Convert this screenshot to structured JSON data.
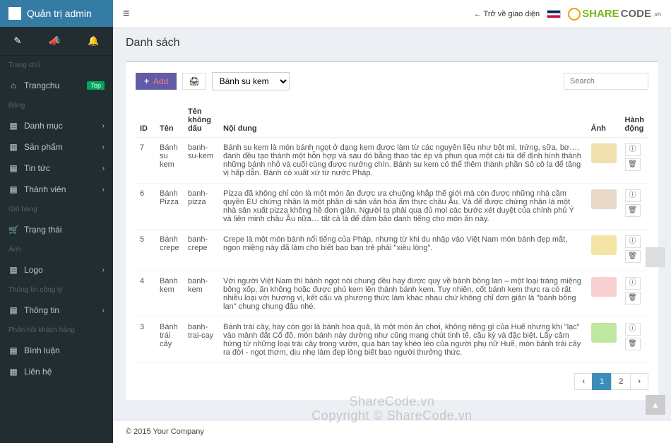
{
  "brand": {
    "title": "Quản trị admin"
  },
  "sidebar": {
    "headers": {
      "h1": "Trang chủ",
      "h2": "Bảng",
      "h3": "Giỏ hàng",
      "h4": "Ảnh",
      "h5": "Thông tin công ty",
      "h6": "Phản hồi khách hàng"
    },
    "items": {
      "trangchu": "Trangchu",
      "danhmuc": "Danh mục",
      "sanpham": "Sản phẩm",
      "tintuc": "Tin tức",
      "thanhvien": "Thành viên",
      "trangthai": "Trạng thái",
      "logo": "Logo",
      "thongtin": "Thông tin",
      "binhluan": "Bình luận",
      "lienhe": "Liên hệ"
    },
    "badge_top": "Top"
  },
  "topbar": {
    "back": "Trở về giao diện",
    "flags": "🇬🇧"
  },
  "logo": {
    "main": "SHARE",
    "sub": "CODE",
    "tld": ".vn"
  },
  "page": {
    "header": "Danh sách",
    "add_label": "Add",
    "category": "Bánh su kem",
    "search_placeholder": "Search"
  },
  "table": {
    "headers": {
      "id": "ID",
      "ten": "Tên",
      "slug": "Tên không dấu",
      "noidung": "Nội dung",
      "anh": "Ảnh",
      "hanhdong": "Hành động"
    },
    "rows": [
      {
        "id": "7",
        "ten": "Bánh su kem",
        "slug": "banh-su-kem",
        "content": "Bánh su kem là món bánh ngọt ở dạng kem được làm từ các nguyên liệu như bột mì, trứng, sữa, bơ…. đánh đều tạo thành một hỗn hợp và sau đó bằng thao tác ép và phun qua một cái túi để định hình thành những bánh nhỏ và cuối cùng được nướng chín. Bánh su kem có thể thêm thành phần Sô cô la để tăng vị hấp dẫn. Bánh có xuất xứ từ nước Pháp."
      },
      {
        "id": "6",
        "ten": "Bánh Pizza",
        "slug": "banh-pizza",
        "content": "Pizza đã không chỉ còn là một món ăn được ưa chuộng khắp thế giới mà còn được những nhà cầm quyền EU chứng nhận là một phần di sản văn hóa ẩm thực châu Âu. Và để được chứng nhận là một nhà sản xuất pizza không hề đơn giản. Người ta phải qua đủ mọi các bước xét duyệt của chính phủ Ý và liên minh châu Âu nữa… tất cả là để đảm bảo danh tiếng cho món ăn này."
      },
      {
        "id": "5",
        "ten": "Bánh crepe",
        "slug": "banh-crepe",
        "content": "Crepe là một món bánh nổi tiếng của Pháp, nhưng từ khi du nhập vào Việt Nam món bánh đẹp mắt, ngon miệng này đã làm cho biết bao bạn trẻ phải \"xiêu lòng\"."
      },
      {
        "id": "4",
        "ten": "Bánh kem",
        "slug": "banh-kem",
        "content": "Với người Việt Nam thì bánh ngọt nói chung đều hay được quy về bánh bông lan – một loại tráng miệng bông xốp, ăn không hoặc được phủ kem lên thành bánh kem. Tuy nhiên, cốt bánh kem thực ra có rất nhiều loại với hương vị, kết cấu và phương thức làm khác nhau chứ không chỉ đơn giản là \"bánh bông lan\" chung chung đâu nhé."
      },
      {
        "id": "3",
        "ten": "Bánh trái cây",
        "slug": "banh-trai-cay",
        "content": "Bánh trái cây, hay còn gọi là bánh hoa quả, là một món ăn chơi, không riêng gì của Huế nhưng khi \"lạc\" vào mảnh đất Cố đô, món bánh này dường như cũng mang chút tinh tế, cầu kỳ và đặc biệt. Lấy cảm hứng từ những loại trái cây trong vườn, qua bàn tay khéo léo của người phụ nữ Huế, món bánh trái cây ra đời - ngọt thơm, dịu nhẹ làm đẹp lòng biết bao người thưởng thức."
      }
    ]
  },
  "pagination": {
    "prev": "‹",
    "p1": "1",
    "p2": "2",
    "next": "›"
  },
  "footer": {
    "copyright": "© 2015 Your Company"
  },
  "watermark": {
    "w1": "ShareCode.vn",
    "w2": "Copyright © ShareCode.vn"
  }
}
